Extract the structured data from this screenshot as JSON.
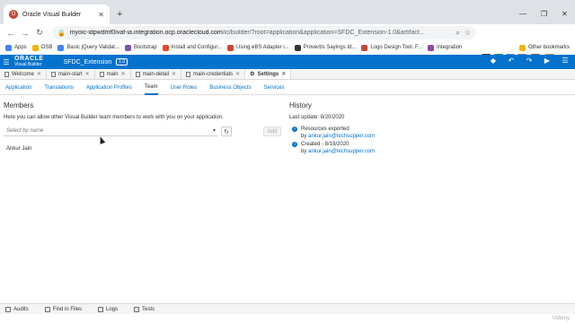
{
  "browser": {
    "tab_title": "Oracle Visual Builder",
    "url_host": "myoic-idpwdmf0ivaf-ia.integration.ocp.oraclecloud.com",
    "url_path": "/ic/builder/?root=application&application=SFDC_Extension-1.0&artifact...",
    "bookmarks": [
      {
        "label": "Apps",
        "color": "#4285f4"
      },
      {
        "label": "OSB",
        "color": "#f4b400"
      },
      {
        "label": "Basic jQuery Validat...",
        "color": "#4285f4"
      },
      {
        "label": "Bootstrap",
        "color": "#7952b3"
      },
      {
        "label": "Install and Configur...",
        "color": "#e34c26"
      },
      {
        "label": "Using eBS Adapter i...",
        "color": "#c74634"
      },
      {
        "label": "Proverbs Sayings Id...",
        "color": "#333333"
      },
      {
        "label": "Logo Design Tool. F...",
        "color": "#c74634"
      },
      {
        "label": "Integration",
        "color": "#8e44ad"
      }
    ],
    "other_bookmarks": "Other bookmarks"
  },
  "vb": {
    "brand_top": "ORACLE",
    "brand_bottom": "Visual Builder",
    "app_name": "SFDC_Extension",
    "version": "1.0",
    "editor_tabs": [
      {
        "label": "Welcome",
        "active": false
      },
      {
        "label": "main-start",
        "active": false
      },
      {
        "label": "main",
        "active": false
      },
      {
        "label": "main-detail",
        "active": false
      },
      {
        "label": "main-credentials",
        "active": false
      },
      {
        "label": "Settings",
        "active": true
      }
    ],
    "sub_tabs": [
      "Application",
      "Translations",
      "Application Profiles",
      "Team",
      "User Roles",
      "Business Objects",
      "Services"
    ],
    "active_sub_tab": "Team"
  },
  "members": {
    "title": "Members",
    "description": "Here you can allow other Visual Builder team members to work with you on your application.",
    "select_placeholder": "Select by name",
    "add_label": "Add",
    "list": [
      "Ankur Jain"
    ]
  },
  "history": {
    "title": "History",
    "last_update": "Last update: 8/20/2020",
    "entries": [
      {
        "action": "Resources exported",
        "by": "by",
        "user": "ankur.jain@techsupper.com"
      },
      {
        "action": "Created - 8/19/2020",
        "by": "by",
        "user": "ankur.jain@techsupper.com"
      }
    ]
  },
  "footer": [
    "Audits",
    "Find in Files",
    "Logs",
    "Tests"
  ],
  "watermark": "Udemy",
  "colors": {
    "accent": "#0572ce",
    "oracle_red": "#c74634"
  }
}
